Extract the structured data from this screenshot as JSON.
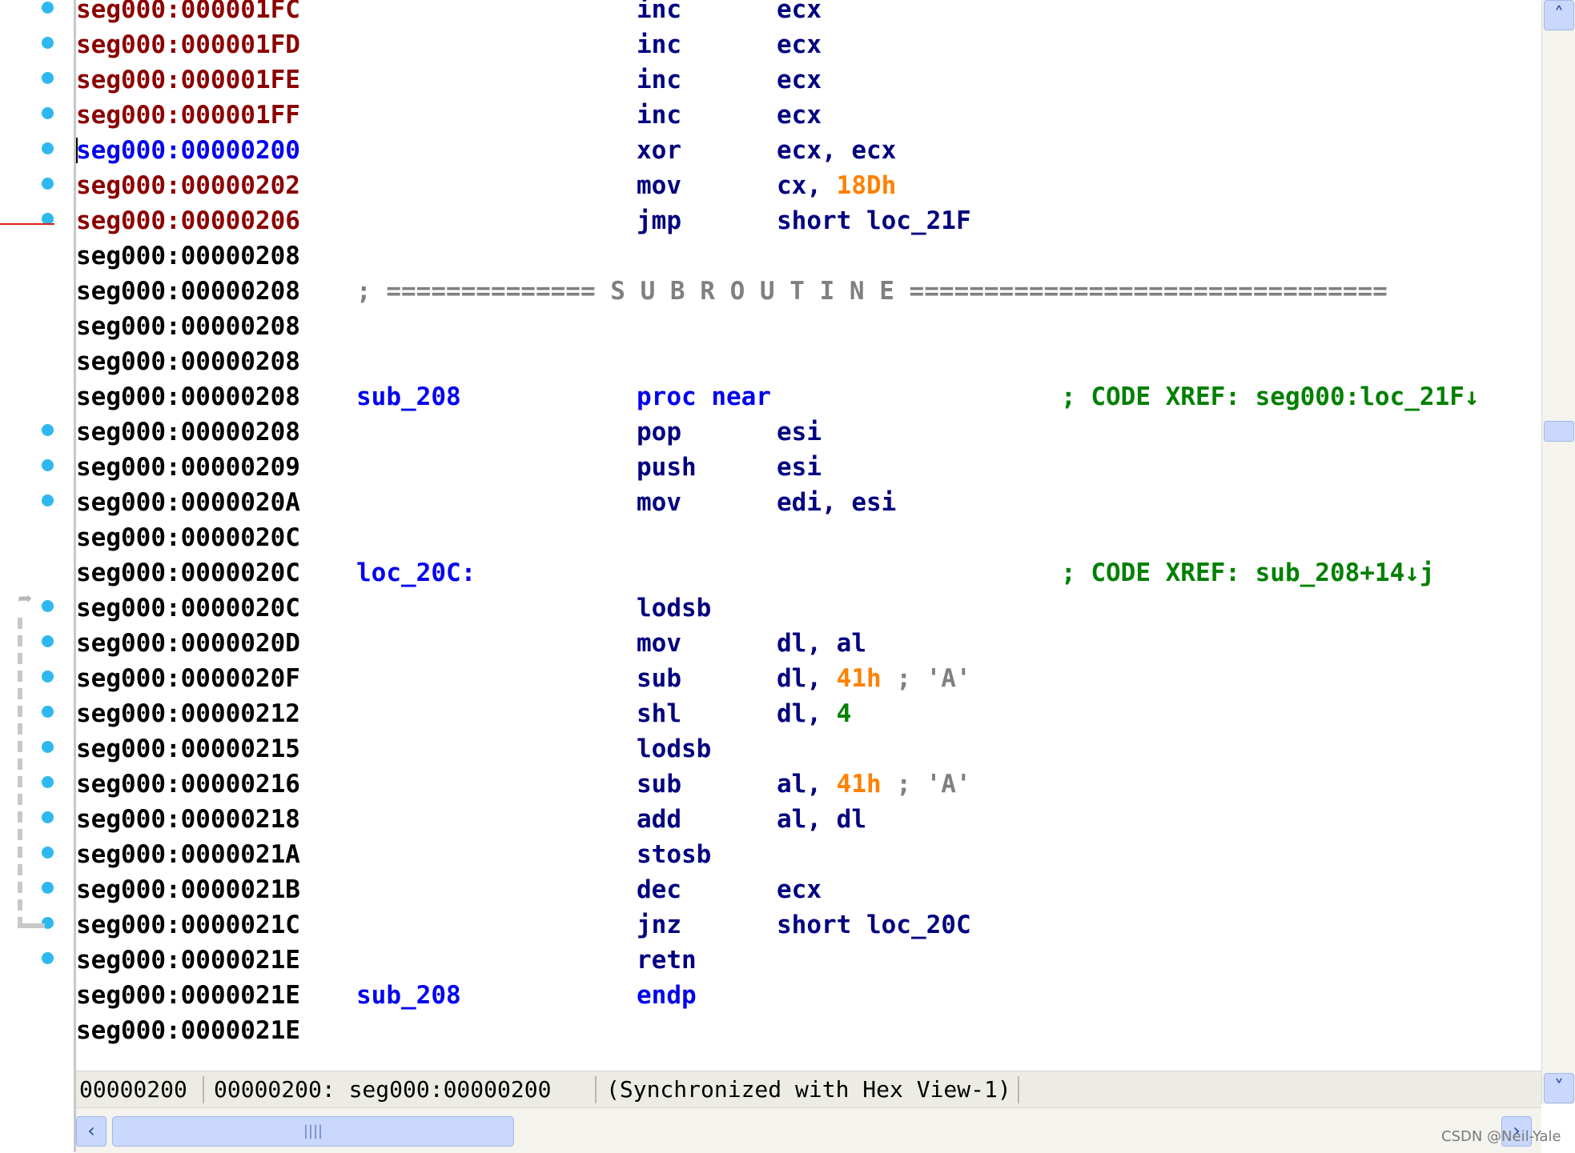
{
  "listing": [
    {
      "addr": "seg000:000001FC",
      "addr_color": "red",
      "label": "",
      "mnemonic": "inc",
      "operand": "ecx",
      "bp": true
    },
    {
      "addr": "seg000:000001FD",
      "addr_color": "red",
      "label": "",
      "mnemonic": "inc",
      "operand": "ecx",
      "bp": true
    },
    {
      "addr": "seg000:000001FE",
      "addr_color": "red",
      "label": "",
      "mnemonic": "inc",
      "operand": "ecx",
      "bp": true
    },
    {
      "addr": "seg000:000001FF",
      "addr_color": "red",
      "label": "",
      "mnemonic": "inc",
      "operand": "ecx",
      "bp": true
    },
    {
      "addr": "seg000:00000200",
      "addr_color": "blue",
      "label": "",
      "mnemonic": "xor",
      "operand": "ecx, ecx",
      "bp": true,
      "cursor": true
    },
    {
      "addr": "seg000:00000202",
      "addr_color": "red",
      "label": "",
      "mnemonic": "mov",
      "operand": "cx, ",
      "num": "18Dh",
      "bp": true
    },
    {
      "addr": "seg000:00000206",
      "addr_color": "red",
      "label": "",
      "mnemonic": "jmp",
      "operand": "short loc_21F",
      "bp": true
    },
    {
      "addr": "seg000:00000208"
    },
    {
      "addr": "seg000:00000208",
      "separator": "; ============== S U B R O U T I N E ================================"
    },
    {
      "addr": "seg000:00000208"
    },
    {
      "addr": "seg000:00000208"
    },
    {
      "addr": "seg000:00000208",
      "label": "sub_208",
      "mnemonic": "proc near",
      "kw": true,
      "xref": "; CODE XREF: seg000:loc_21F↓"
    },
    {
      "addr": "seg000:00000208",
      "mnemonic": "pop",
      "operand": "esi",
      "bp": true
    },
    {
      "addr": "seg000:00000209",
      "mnemonic": "push",
      "operand": "esi",
      "bp": true
    },
    {
      "addr": "seg000:0000020A",
      "mnemonic": "mov",
      "operand": "edi, esi",
      "bp": true
    },
    {
      "addr": "seg000:0000020C"
    },
    {
      "addr": "seg000:0000020C",
      "label": "loc_20C:",
      "xref": "; CODE XREF: sub_208+14↓j"
    },
    {
      "addr": "seg000:0000020C",
      "mnemonic": "lodsb",
      "bp": true
    },
    {
      "addr": "seg000:0000020D",
      "mnemonic": "mov",
      "operand": "dl, al",
      "bp": true
    },
    {
      "addr": "seg000:0000020F",
      "mnemonic": "sub",
      "operand": "dl, ",
      "num": "41h",
      "comment": " ; 'A'",
      "bp": true
    },
    {
      "addr": "seg000:00000212",
      "mnemonic": "shl",
      "operand": "dl, ",
      "num": "4",
      "num_green": true,
      "bp": true
    },
    {
      "addr": "seg000:00000215",
      "mnemonic": "lodsb",
      "bp": true
    },
    {
      "addr": "seg000:00000216",
      "mnemonic": "sub",
      "operand": "al, ",
      "num": "41h",
      "comment": " ; 'A'",
      "bp": true
    },
    {
      "addr": "seg000:00000218",
      "mnemonic": "add",
      "operand": "al, dl",
      "bp": true
    },
    {
      "addr": "seg000:0000021A",
      "mnemonic": "stosb",
      "bp": true
    },
    {
      "addr": "seg000:0000021B",
      "mnemonic": "dec",
      "operand": "ecx",
      "bp": true
    },
    {
      "addr": "seg000:0000021C",
      "mnemonic": "jnz",
      "operand": "short loc_20C",
      "bp": true
    },
    {
      "addr": "seg000:0000021E",
      "mnemonic": "retn",
      "bp": true
    },
    {
      "addr": "seg000:0000021E",
      "label": "sub_208",
      "mnemonic": "endp",
      "kw": true
    },
    {
      "addr": "seg000:0000021E"
    }
  ],
  "status": {
    "offset": "00000200",
    "location": "00000200: seg000:00000200",
    "sync": "(Synchronized with Hex View-1)"
  },
  "colors": {
    "address_normal": "#000000",
    "address_breakpoint": "#8b0000",
    "address_current": "#0000ee",
    "mnemonic": "#000080",
    "keyword": "#0000ee",
    "immediate": "#ff8000",
    "xref": "#008000",
    "breakpoint_dot": "#2fb8ef"
  },
  "scrollbars": {
    "up_icon": "chevron-up",
    "down_icon": "chevron-down",
    "left_icon": "chevron-left",
    "right_icon": "chevron-right",
    "hthumb_grip": "||||"
  },
  "watermark": "CSDN @Neil-Yale"
}
